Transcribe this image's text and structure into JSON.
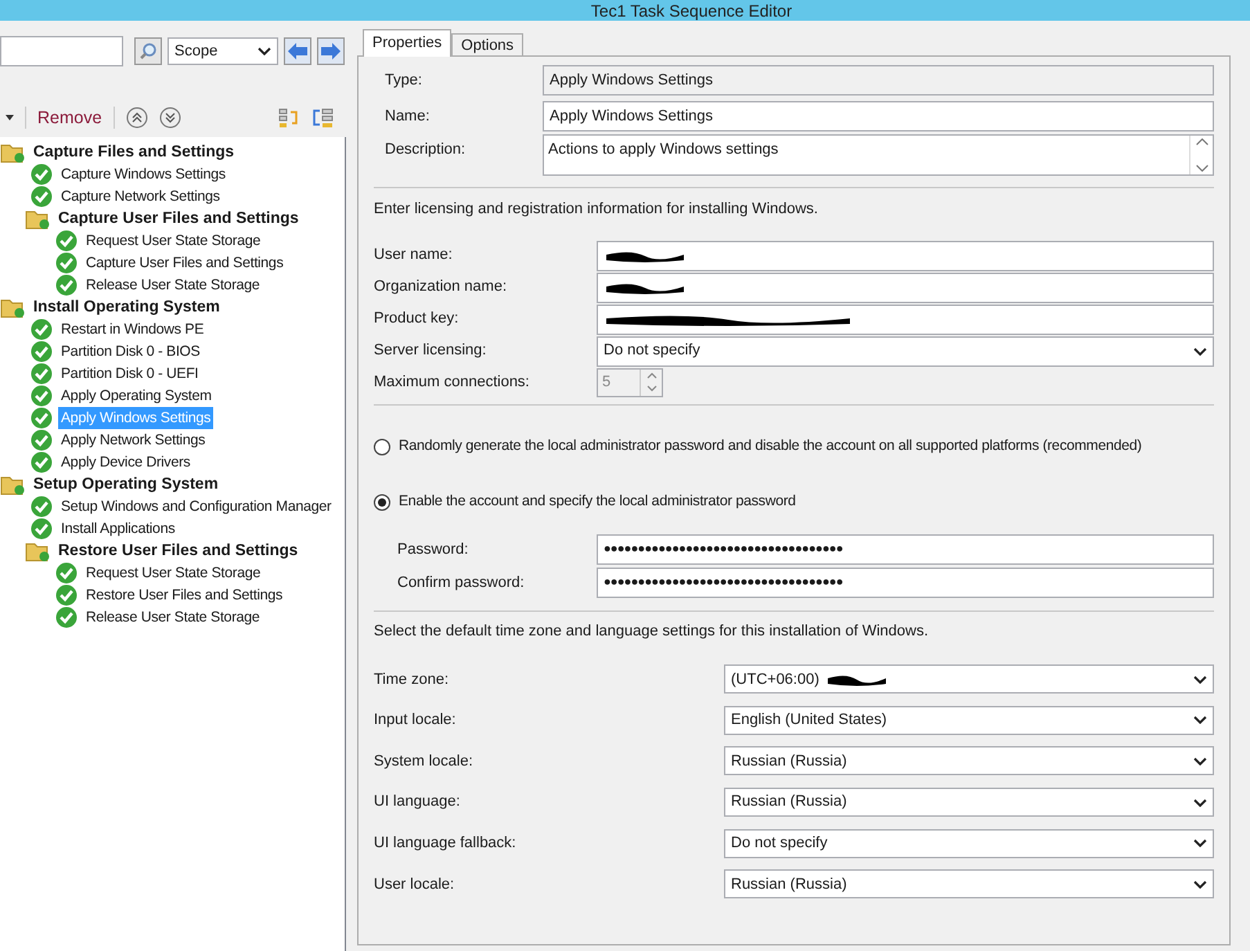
{
  "window": {
    "title": "Tec1 Task Sequence Editor"
  },
  "search": {
    "scope": "Scope"
  },
  "toolbar": {
    "remove": "Remove"
  },
  "tree": [
    {
      "kind": "group",
      "label": "Capture Files and Settings",
      "selected": false,
      "children": [
        {
          "kind": "step",
          "label": "Capture Windows Settings",
          "selected": false
        },
        {
          "kind": "step",
          "label": "Capture Network Settings",
          "selected": false
        },
        {
          "kind": "group",
          "label": "Capture User Files and Settings",
          "selected": false,
          "children": [
            {
              "kind": "step",
              "label": "Request User State Storage",
              "selected": false
            },
            {
              "kind": "step",
              "label": "Capture User Files and Settings",
              "selected": false
            },
            {
              "kind": "step",
              "label": "Release User State Storage",
              "selected": false
            }
          ]
        }
      ]
    },
    {
      "kind": "group",
      "label": "Install Operating System",
      "selected": false,
      "children": [
        {
          "kind": "step",
          "label": "Restart in Windows PE",
          "selected": false
        },
        {
          "kind": "step",
          "label": "Partition Disk 0 - BIOS",
          "selected": false
        },
        {
          "kind": "step",
          "label": "Partition Disk 0 - UEFI",
          "selected": false
        },
        {
          "kind": "step",
          "label": "Apply Operating System",
          "selected": false
        },
        {
          "kind": "step",
          "label": "Apply Windows Settings",
          "selected": true
        },
        {
          "kind": "step",
          "label": "Apply Network Settings",
          "selected": false
        },
        {
          "kind": "step",
          "label": "Apply Device Drivers",
          "selected": false
        }
      ]
    },
    {
      "kind": "group",
      "label": "Setup Operating System",
      "selected": false,
      "children": [
        {
          "kind": "step",
          "label": "Setup Windows and Configuration Manager",
          "selected": false
        },
        {
          "kind": "step",
          "label": "Install Applications",
          "selected": false
        },
        {
          "kind": "group",
          "label": "Restore User Files and Settings",
          "selected": false,
          "children": [
            {
              "kind": "step",
              "label": "Request User State Storage",
              "selected": false
            },
            {
              "kind": "step",
              "label": "Restore User Files and Settings",
              "selected": false
            },
            {
              "kind": "step",
              "label": "Release User State Storage",
              "selected": false
            }
          ]
        }
      ]
    }
  ],
  "tabs": [
    {
      "label": "Properties",
      "selected": true
    },
    {
      "label": "Options",
      "selected": false
    }
  ],
  "general": [
    {
      "kind": "readonly",
      "label": "Type:",
      "value": "Apply Windows Settings"
    },
    {
      "kind": "text",
      "label": "Name:",
      "value": "Apply Windows Settings"
    },
    {
      "kind": "textarea",
      "label": "Description:",
      "value": "Actions to apply Windows settings"
    }
  ],
  "licensing_intro": "Enter licensing and registration information for installing Windows.",
  "licensing": [
    {
      "kind": "redacted",
      "label": "User name:"
    },
    {
      "kind": "redacted",
      "label": "Organization name:"
    },
    {
      "kind": "redacted",
      "label": "Product key:"
    },
    {
      "kind": "select",
      "label": "Server licensing:",
      "value": "Do not specify"
    },
    {
      "kind": "spin",
      "label": "Maximum connections:",
      "value": "5",
      "disabled": true
    }
  ],
  "admin_options": [
    {
      "label": "Randomly generate the local administrator password and disable the account on all supported platforms (recommended)",
      "selected": false
    },
    {
      "label": "Enable the account and specify the local administrator password",
      "selected": true
    }
  ],
  "passwords": [
    {
      "label": "Password:",
      "value": "●●●●●●●●●●●●●●●●●●●●●●●●●●●●●●●●●●●"
    },
    {
      "label": "Confirm password:",
      "value": "●●●●●●●●●●●●●●●●●●●●●●●●●●●●●●●●●●●"
    }
  ],
  "locale_intro": "Select the default time zone and language settings for this installation of Windows.",
  "locale": [
    {
      "label": "Time zone:",
      "value": "(UTC+06:00)",
      "redacted": true
    },
    {
      "label": "Input locale:",
      "value": "English (United States)",
      "redacted": false
    },
    {
      "label": "System locale:",
      "value": "Russian (Russia)",
      "redacted": false
    },
    {
      "label": "UI language:",
      "value": "Russian (Russia)",
      "redacted": false
    },
    {
      "label": "UI language fallback:",
      "value": "Do not specify",
      "redacted": false
    },
    {
      "label": "User locale:",
      "value": "Russian (Russia)",
      "redacted": false
    }
  ]
}
